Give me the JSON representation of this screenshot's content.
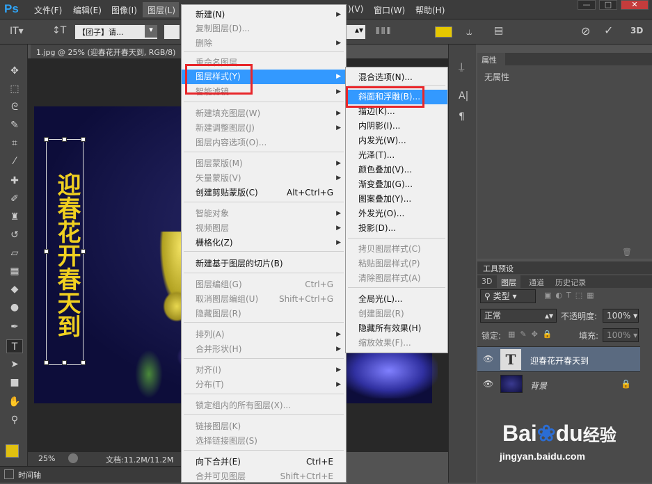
{
  "app": {
    "logo": "Ps"
  },
  "menubar": {
    "file": "文件(F)",
    "edit": "编辑(E)",
    "image": "图像(I)",
    "layer": "图层(L)",
    "window_cut": ")(V)",
    "window": "窗口(W)",
    "help": "帮助(H)"
  },
  "window_controls": {
    "minimize": "—",
    "maximize": "□",
    "close": "✕"
  },
  "options": {
    "font": "【团子】请...",
    "mode_3d": "3D"
  },
  "doc": {
    "tab": "1.jpg @ 25% (迎春花开春天到, RGB/8)",
    "zoom": "25%",
    "docsize": "文档:11.2M/11.2M"
  },
  "canvas_text": "迎春花开春天到",
  "timeline": "时间轴",
  "layer_menu": {
    "items": [
      {
        "label": "新建(N)",
        "enabled": true,
        "shortcut": "",
        "submenu": true
      },
      {
        "label": "复制图层(D)...",
        "enabled": false,
        "shortcut": ""
      },
      {
        "label": "删除",
        "enabled": false,
        "shortcut": "",
        "submenu": true
      },
      {
        "label": "重命名图层...",
        "enabled": false,
        "shortcut": ""
      },
      {
        "label": "图层样式(Y)",
        "enabled": true,
        "shortcut": "",
        "submenu": true,
        "highlighted": true
      },
      {
        "label": "智能滤镜",
        "enabled": false,
        "shortcut": "",
        "submenu": true
      },
      {
        "label": "新建填充图层(W)",
        "enabled": false,
        "shortcut": "",
        "submenu": true
      },
      {
        "label": "新建调整图层(J)",
        "enabled": false,
        "shortcut": "",
        "submenu": true
      },
      {
        "label": "图层内容选项(O)...",
        "enabled": false,
        "shortcut": ""
      },
      {
        "label": "图层蒙版(M)",
        "enabled": false,
        "shortcut": "",
        "submenu": true
      },
      {
        "label": "矢量蒙版(V)",
        "enabled": false,
        "shortcut": "",
        "submenu": true
      },
      {
        "label": "创建剪贴蒙版(C)",
        "enabled": true,
        "shortcut": "Alt+Ctrl+G"
      },
      {
        "label": "智能对象",
        "enabled": false,
        "shortcut": "",
        "submenu": true
      },
      {
        "label": "视频图层",
        "enabled": false,
        "shortcut": "",
        "submenu": true
      },
      {
        "label": "栅格化(Z)",
        "enabled": true,
        "shortcut": "",
        "submenu": true
      },
      {
        "label": "新建基于图层的切片(B)",
        "enabled": true,
        "shortcut": ""
      },
      {
        "label": "图层编组(G)",
        "enabled": false,
        "shortcut": "Ctrl+G"
      },
      {
        "label": "取消图层编组(U)",
        "enabled": false,
        "shortcut": "Shift+Ctrl+G"
      },
      {
        "label": "隐藏图层(R)",
        "enabled": false,
        "shortcut": ""
      },
      {
        "label": "排列(A)",
        "enabled": false,
        "shortcut": "",
        "submenu": true
      },
      {
        "label": "合并形状(H)",
        "enabled": false,
        "shortcut": "",
        "submenu": true
      },
      {
        "label": "对齐(I)",
        "enabled": false,
        "shortcut": "",
        "submenu": true
      },
      {
        "label": "分布(T)",
        "enabled": false,
        "shortcut": "",
        "submenu": true
      },
      {
        "label": "锁定组内的所有图层(X)...",
        "enabled": false,
        "shortcut": ""
      },
      {
        "label": "链接图层(K)",
        "enabled": false,
        "shortcut": ""
      },
      {
        "label": "选择链接图层(S)",
        "enabled": false,
        "shortcut": ""
      },
      {
        "label": "向下合并(E)",
        "enabled": true,
        "shortcut": "Ctrl+E"
      },
      {
        "label": "合并可见图层",
        "enabled": false,
        "shortcut": "Shift+Ctrl+E"
      }
    ]
  },
  "style_submenu": {
    "items": [
      {
        "label": "混合选项(N)...",
        "enabled": true
      },
      {
        "label": "斜面和浮雕(B)...",
        "enabled": true,
        "highlighted": true
      },
      {
        "label": "描边(K)...",
        "enabled": true
      },
      {
        "label": "内阴影(I)...",
        "enabled": true
      },
      {
        "label": "内发光(W)...",
        "enabled": true
      },
      {
        "label": "光泽(T)...",
        "enabled": true
      },
      {
        "label": "颜色叠加(V)...",
        "enabled": true
      },
      {
        "label": "渐变叠加(G)...",
        "enabled": true
      },
      {
        "label": "图案叠加(Y)...",
        "enabled": true
      },
      {
        "label": "外发光(O)...",
        "enabled": true
      },
      {
        "label": "投影(D)...",
        "enabled": true
      },
      {
        "label": "拷贝图层样式(C)",
        "enabled": false
      },
      {
        "label": "粘贴图层样式(P)",
        "enabled": false
      },
      {
        "label": "清除图层样式(A)",
        "enabled": false
      },
      {
        "label": "全局光(L)...",
        "enabled": true
      },
      {
        "label": "创建图层(R)",
        "enabled": false
      },
      {
        "label": "隐藏所有效果(H)",
        "enabled": true
      },
      {
        "label": "缩放效果(F)...",
        "enabled": false
      }
    ]
  },
  "props_panel": {
    "tab": "属性",
    "empty": "无属性"
  },
  "layers_panel": {
    "tool_preset_tab": "工具预设",
    "tabs": [
      "3D",
      "图层",
      "通道",
      "历史记录"
    ],
    "filter": "类型",
    "blend": "正常",
    "opacity_label": "不透明度:",
    "opacity": "100%",
    "lock_label": "锁定:",
    "fill_label": "填充:",
    "fill": "100%",
    "layers": [
      {
        "name": "迎春花开春天到",
        "thumb": "T"
      },
      {
        "name": "背景"
      }
    ]
  },
  "colors": {
    "menu_highlight": "#3399ff",
    "callout": "#e8262a",
    "text_yellow": "#f0d020",
    "fg_swatch": "#e0c010"
  },
  "watermark": {
    "brand": "Bai",
    "brand2": "du",
    "suffix": "经验",
    "url": "jingyan.baidu.com"
  }
}
